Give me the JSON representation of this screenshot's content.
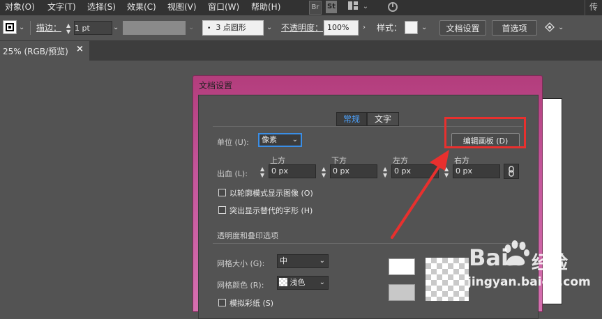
{
  "menu": [
    "对象(O)",
    "文字(T)",
    "选择(S)",
    "效果(C)",
    "视图(V)",
    "窗口(W)",
    "帮助(H)"
  ],
  "menu_right": {
    "br": "Br",
    "st": "St",
    "edge_text": "传"
  },
  "controlbar": {
    "stroke_label": "描边：",
    "stroke_value": "1 pt",
    "brush_value": "3 点圆形",
    "opacity_label": "不透明度：",
    "opacity_value": "100%",
    "style_label": "样式：",
    "doc_setup_button": "文档设置",
    "prefs_button": "首选项"
  },
  "tab": {
    "title": "25% (RGB/预览)",
    "close": "×"
  },
  "dialog": {
    "title": "文档设置",
    "tabs": [
      "常规",
      "文字"
    ],
    "units_label": "单位 (U):",
    "units_value": "像素",
    "edit_artboards_button": "编辑画板 (D)",
    "bleed_label": "出血 (L):",
    "bleed_headers": [
      "上方",
      "下方",
      "左方",
      "右方"
    ],
    "bleed_values": [
      "0 px",
      "0 px",
      "0 px",
      "0 px"
    ],
    "outline_checkbox": "以轮廓模式显示图像 (O)",
    "glyph_checkbox": "突出显示替代的字形 (H)",
    "transparency_section": "透明度和叠印选项",
    "grid_size_label": "网格大小 (G):",
    "grid_size_value": "中",
    "grid_color_label": "网格颜色 (R):",
    "grid_color_value": "浅色",
    "simulate_paper": "模拟彩纸 (S)"
  },
  "watermark": {
    "brand_a": "Bai",
    "brand_b": "经验",
    "url": "jingyan.baidu.com"
  },
  "colors": {
    "annotation": "#e8302e",
    "dialog_title_bg": "#c04a8a",
    "panel": "#535353",
    "accent_tab": "#3c3c3c",
    "link_blue": "#4da3ff"
  }
}
